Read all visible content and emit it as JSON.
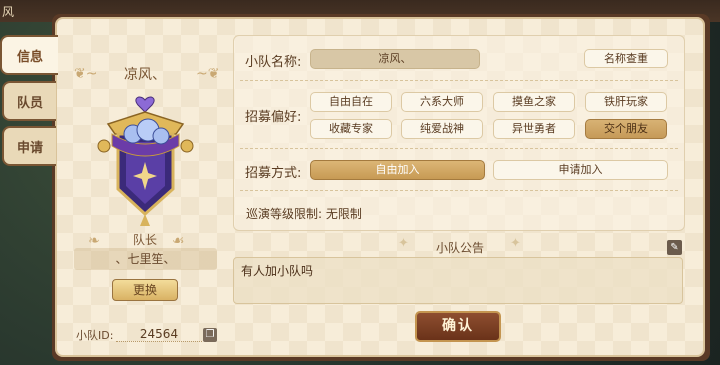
{
  "window": {
    "title": "风"
  },
  "tabs": [
    {
      "label": "信息"
    },
    {
      "label": "队员"
    },
    {
      "label": "申请"
    }
  ],
  "left": {
    "team_name": "凉风、",
    "leader_label": "队长",
    "leader_name": "、七里笙、",
    "change_button": "更换",
    "team_id_label": "小队ID:",
    "team_id_value": "24564"
  },
  "settings": {
    "name_label": "小队名称:",
    "name_value": "凉风、",
    "name_check_button": "名称查重",
    "preference_label": "招募偏好:",
    "preference_tags": [
      "自由自在",
      "六系大师",
      "摸鱼之家",
      "铁肝玩家",
      "收藏专家",
      "纯爱战神",
      "异世勇者",
      "交个朋友"
    ],
    "selected_preference": "交个朋友",
    "method_label": "招募方式:",
    "method_options": [
      "自由加入",
      "申请加入"
    ],
    "selected_method": "自由加入",
    "level_limit": "巡演等级限制: 无限制"
  },
  "notice": {
    "title": "小队公告",
    "content": "有人加小队吗"
  },
  "confirm_button": "确认",
  "colors": {
    "panel": "#f7edd9",
    "frame": "#5a3a26",
    "accent_selected": "#c79a54",
    "confirm": "#7a3d22"
  }
}
